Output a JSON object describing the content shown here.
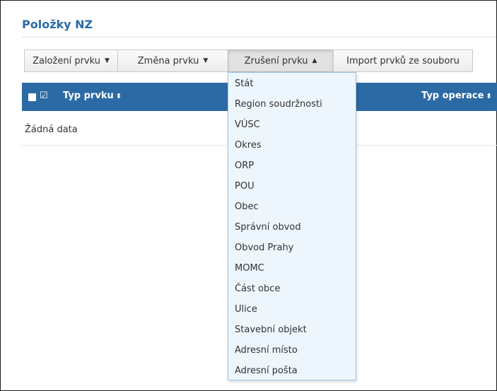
{
  "page": {
    "title": "Položky NZ"
  },
  "toolbar": {
    "buttons": [
      {
        "label": "Založení prvku",
        "caret": "▼",
        "state": "closed"
      },
      {
        "label": "Změna prvku",
        "caret": "▼",
        "state": "closed"
      },
      {
        "label": "Zrušení prvku",
        "caret": "▲",
        "state": "open"
      },
      {
        "label": "Import prvků ze souboru",
        "caret": "",
        "state": "closed"
      }
    ]
  },
  "grid": {
    "header_color": "#2c6aa5",
    "select_all_icon": "check-square-icon",
    "select_all_glyph": "☑",
    "columns": [
      {
        "label": "Typ prvku",
        "sort_glyph": "⬍"
      },
      {
        "label": "Typ operace",
        "sort_glyph": "⬍"
      }
    ],
    "empty_text": "Žádná data"
  },
  "dropdown": {
    "items": [
      "Stát",
      "Region soudržnosti",
      "VÚSC",
      "Okres",
      "ORP",
      "POU",
      "Obec",
      "Správní obvod",
      "Obvod Prahy",
      "MOMC",
      "Část obce",
      "Ulice",
      "Stavební objekt",
      "Adresní místo",
      "Adresní pošta"
    ]
  },
  "colors": {
    "accent": "#2a6ca8",
    "dropdown_bg": "#eef6fd",
    "dropdown_border": "#9ec3e6"
  }
}
